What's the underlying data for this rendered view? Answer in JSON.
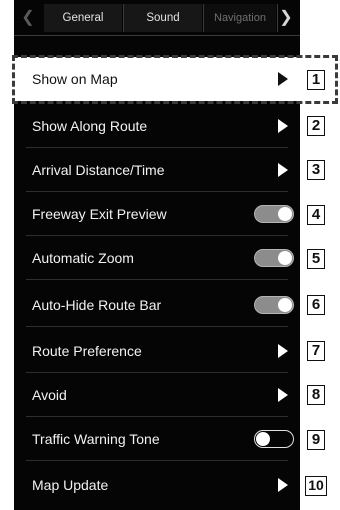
{
  "tabs": {
    "general": "General",
    "sound": "Sound",
    "navigation": "Navigation"
  },
  "icons": {
    "prev": "chevron-left-icon",
    "next": "chevron-right-icon",
    "submenu": "triangle-right-icon"
  },
  "rows": [
    {
      "label": "Show on Map",
      "control": "arrow",
      "callout": "1",
      "highlighted": true
    },
    {
      "label": "Show Along Route",
      "control": "arrow",
      "callout": "2"
    },
    {
      "label": "Arrival Distance/Time",
      "control": "arrow",
      "callout": "3"
    },
    {
      "label": "Freeway Exit Preview",
      "control": "toggle",
      "state": "on",
      "callout": "4"
    },
    {
      "label": "Automatic Zoom",
      "control": "toggle",
      "state": "on",
      "callout": "5"
    },
    {
      "label": "Auto-Hide Route Bar",
      "control": "toggle",
      "state": "on",
      "callout": "6"
    },
    {
      "label": "Route Preference",
      "control": "arrow",
      "callout": "7"
    },
    {
      "label": "Avoid",
      "control": "arrow",
      "callout": "8"
    },
    {
      "label": "Traffic Warning Tone",
      "control": "toggle",
      "state": "off",
      "callout": "9"
    },
    {
      "label": "Map Update",
      "control": "arrow",
      "callout": "10"
    }
  ],
  "colors": {
    "screen_bg": "#050505",
    "highlight_bg": "#ffffff",
    "toggle_on": "#8c8c8c"
  }
}
